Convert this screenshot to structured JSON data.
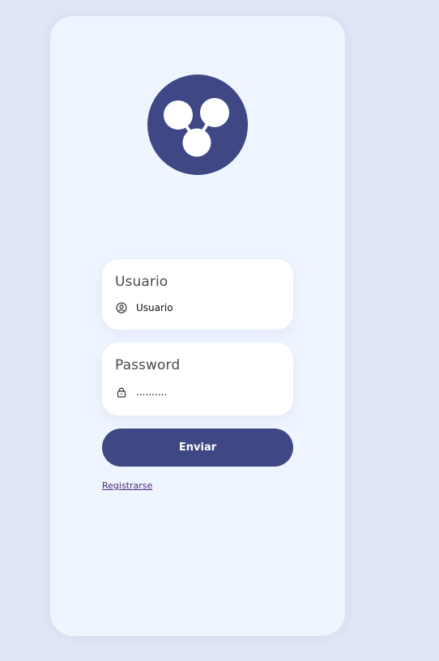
{
  "colors": {
    "page_background": "#dfe6f5",
    "card_background": "#eff5fe",
    "brand": "#3f4885",
    "link": "#4b2a73"
  },
  "logo": {
    "icon": "three-circles-logo-icon"
  },
  "form": {
    "username": {
      "label": "Usuario",
      "placeholder": "Usuario",
      "icon": "user-circle-icon"
    },
    "password": {
      "label": "Password",
      "value": "..........",
      "icon": "lock-icon"
    },
    "submit_label": "Enviar",
    "register_link": "Registrarse"
  }
}
